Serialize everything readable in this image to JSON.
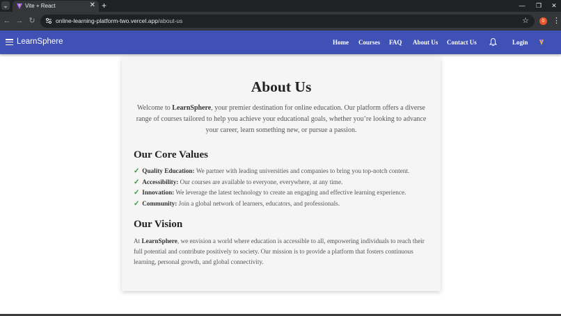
{
  "browser": {
    "tab_title": "Vite + React",
    "tab_close": "✕",
    "new_tab": "+",
    "url_host": "online-learning-platform-two.vercel.app",
    "url_path": "/about-us",
    "profile_badge": "0"
  },
  "header": {
    "brand": "LearnSphere",
    "nav": [
      "Home",
      "Courses",
      "FAQ",
      "About Us",
      "Contact Us"
    ],
    "login": "Login"
  },
  "about": {
    "title": "About Us",
    "intro_prefix": "Welcome to ",
    "intro_brand": "LearnSphere",
    "intro_rest": ", your premier destination for online education. Our platform offers a diverse range of courses tailored to help you achieve your educational goals, whether you’re looking to advance your career, learn something new, or pursue a passion.",
    "values_heading": "Our Core Values",
    "values": [
      {
        "check": "✓",
        "label": "Quality Education:",
        "text": " We partner with leading universities and companies to bring you top-notch content."
      },
      {
        "check": "✓",
        "label": "Accessibility:",
        "text": " Our courses are available to everyone, everywhere, at any time."
      },
      {
        "check": "✓",
        "label": "Innovation:",
        "text": " We leverage the latest technology to create an engaging and effective learning experience."
      },
      {
        "check": "✓",
        "label": "Community:",
        "text": " Join a global network of learners, educators, and professionals."
      }
    ],
    "vision_heading": "Our Vision",
    "vision_prefix": "At ",
    "vision_brand": "LearnSphere",
    "vision_rest": ", we envision a world where education is accessible to all, empowering individuals to reach their full potential and contribute positively to society. Our mission is to provide a platform that fosters continuous learning, personal growth, and global connectivity."
  },
  "colors": {
    "appbar": "#3f51b5",
    "card": "#f5f5f5",
    "check": "#2e9a39",
    "chrome_dark": "#202124",
    "chrome_toolbar": "#35363a"
  },
  "icons": {
    "tab_list": "chevron-down-icon",
    "back": "back-arrow-icon",
    "forward": "forward-arrow-icon",
    "reload": "reload-icon",
    "site_info": "tune-icon",
    "bookmark": "star-icon",
    "menu": "hamburger-menu-icon",
    "notifications": "bell-icon",
    "window_controls": [
      "minimize-icon",
      "restore-icon",
      "close-icon"
    ]
  }
}
